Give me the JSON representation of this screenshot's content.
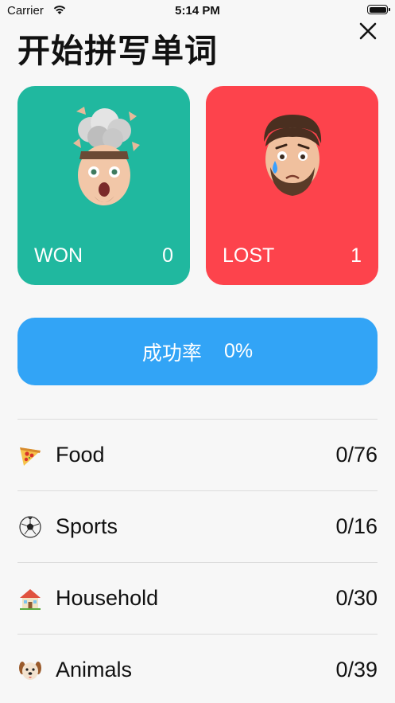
{
  "status_bar": {
    "carrier": "Carrier",
    "time": "5:14 PM"
  },
  "header": {
    "title": "开始拼写单词",
    "close_icon": "close-icon"
  },
  "stats": {
    "won": {
      "label": "WON",
      "value": "0",
      "color": "#20b89f"
    },
    "lost": {
      "label": "LOST",
      "value": "1",
      "color": "#fd434c"
    }
  },
  "rate": {
    "label": "成功率",
    "value": "0%",
    "color": "#32a4f6"
  },
  "categories": [
    {
      "name": "Food",
      "count": "0/76",
      "icon": "pizza-icon"
    },
    {
      "name": "Sports",
      "count": "0/16",
      "icon": "soccer-ball-icon"
    },
    {
      "name": "Household",
      "count": "0/30",
      "icon": "house-icon"
    },
    {
      "name": "Animals",
      "count": "0/39",
      "icon": "dog-icon"
    }
  ]
}
